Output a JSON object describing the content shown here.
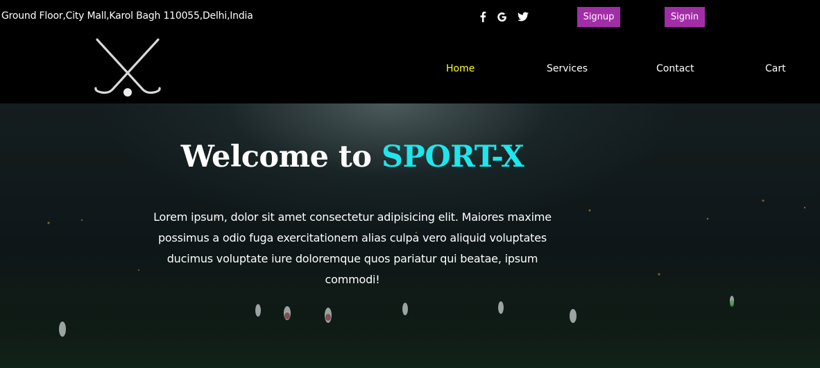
{
  "topbar": {
    "address": "Ground Floor,City Mall,Karol Bagh 110055,Delhi,India",
    "social_icons": [
      "facebook-icon",
      "google-icon",
      "twitter-icon"
    ],
    "signup_label": "Signup",
    "signin_label": "Signin",
    "button_color": "#a22ea7"
  },
  "logo": {
    "icon": "crossed-hockey-sticks-icon"
  },
  "nav": {
    "items": [
      {
        "label": "Home",
        "active": true
      },
      {
        "label": "Services",
        "active": false
      },
      {
        "label": "Contact",
        "active": false
      },
      {
        "label": "Cart",
        "active": false
      }
    ],
    "active_color": "#ffff1a"
  },
  "hero": {
    "title_prefix": "Welcome to ",
    "title_brand": "SPORT-X",
    "brand_color": "#1ee6ec",
    "text": "Lorem ipsum, dolor sit amet consectetur adipisicing elit. Maiores maxime possimus a odio fuga exercitationem alias culpa vero aliquid voluptates ducimus voluptate iure doloremque quos pariatur qui beatae, ipsum commodi!"
  }
}
